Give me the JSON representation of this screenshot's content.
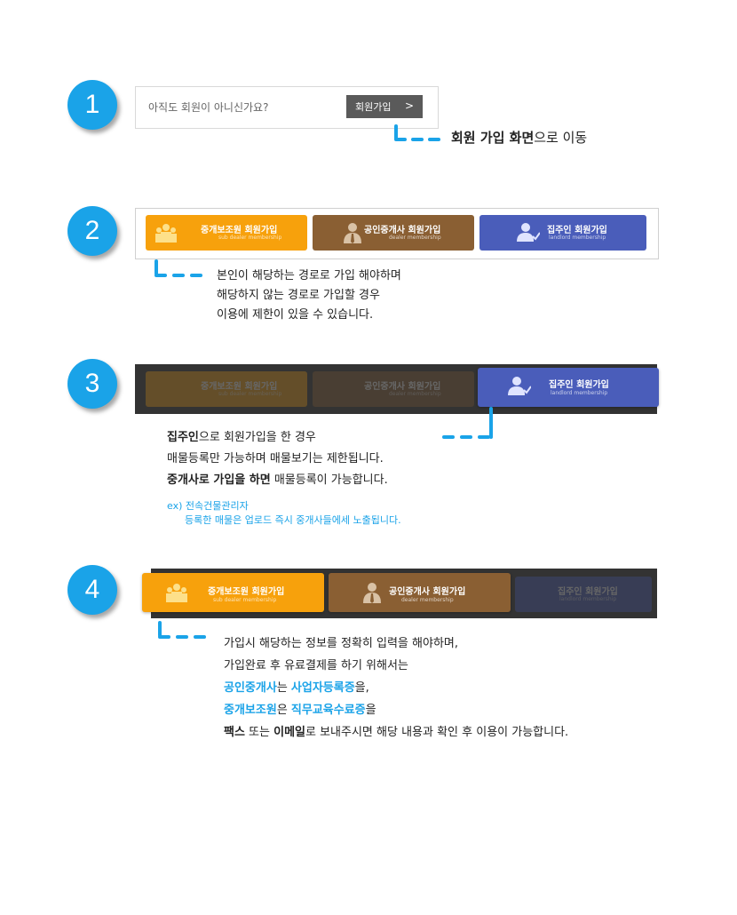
{
  "steps": [
    {
      "number": "1"
    },
    {
      "number": "2"
    },
    {
      "number": "3"
    },
    {
      "number": "4"
    }
  ],
  "step1": {
    "question": "아직도 회원이 아니신가요?",
    "button_label": "회원가입",
    "button_chevron": ">",
    "note_bold": "회원 가입 화면",
    "note_rest": "으로 이동"
  },
  "member_buttons": {
    "sub_dealer": {
      "title": "중개보조원 회원가입",
      "subtitle": "sub dealer membership",
      "icon": "people-group-icon"
    },
    "dealer": {
      "title": "공인중개사 회원가입",
      "subtitle": "dealer membership",
      "icon": "person-tie-icon"
    },
    "landlord": {
      "title": "집주인 회원가입",
      "subtitle": "landlord membership",
      "icon": "person-check-icon"
    }
  },
  "step2": {
    "lines": [
      "본인이 해당하는 경로로 가입 해야하며",
      "해당하지 않는 경로로 가입할 경우",
      "이용에 제한이 있을 수 있습니다."
    ]
  },
  "step3": {
    "line1_bold": "집주인",
    "line1_rest": "으로 회원가입을 한 경우",
    "line2": "매물등록만 가능하며 매물보기는 제한됩니다.",
    "line3_bold": "중개사로 가입을 하면",
    "line3_rest": " 매물등록이 가능합니다.",
    "ex_line1": "ex) 전속건물관리자",
    "ex_line2": "등록한 매물은 업로드 즉시 중개사들에세 노출됩니다."
  },
  "step4": {
    "line1": "가입시 해당하는 정보를 정확히 입력을 해야하며,",
    "line2": "가입완료 후 유료결제를 하기 위해서는",
    "line3_blue1": "공인중개사",
    "line3_mid": "는 ",
    "line3_blue2": "사업자등록증",
    "line3_end": "을,",
    "line4_blue1": "중개보조원",
    "line4_mid": "은 ",
    "line4_blue2": "직무교육수료증",
    "line4_end": "을",
    "line5_bold1": "팩스",
    "line5_mid": " 또는 ",
    "line5_bold2": "이메일",
    "line5_end": "로 보내주시면 해당 내용과 확인 후 이용이 가능합니다."
  },
  "colors": {
    "accent": "#1aa3e8",
    "orange": "#f7a10c",
    "brown": "#8a5f33",
    "indigo": "#4a5dba",
    "dark_panel": "#333333"
  }
}
